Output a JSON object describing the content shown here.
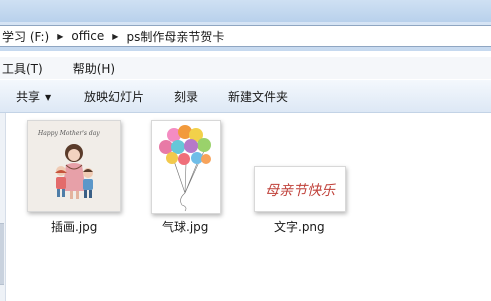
{
  "address": {
    "crumbs": [
      "学习 (F:)",
      "office",
      "ps制作母亲节贺卡"
    ],
    "separator_icon": "chevron-right-icon"
  },
  "menu": {
    "items": [
      "工具(T)",
      "帮助(H)"
    ]
  },
  "toolbar": {
    "share_label": "共享",
    "slideshow_label": "放映幻灯片",
    "burn_label": "刻录",
    "new_folder_label": "新建文件夹"
  },
  "files": [
    {
      "name": "插画.jpg",
      "thumb_text": "Happy Mother's day",
      "icon": "mother-children-illustration"
    },
    {
      "name": "气球.jpg",
      "icon": "balloons-illustration"
    },
    {
      "name": "文字.png",
      "thumb_text": "母亲节快乐",
      "icon": "text-image"
    }
  ],
  "colors": {
    "accent": "#1e3f7a",
    "festive_red": "#c0413a"
  }
}
